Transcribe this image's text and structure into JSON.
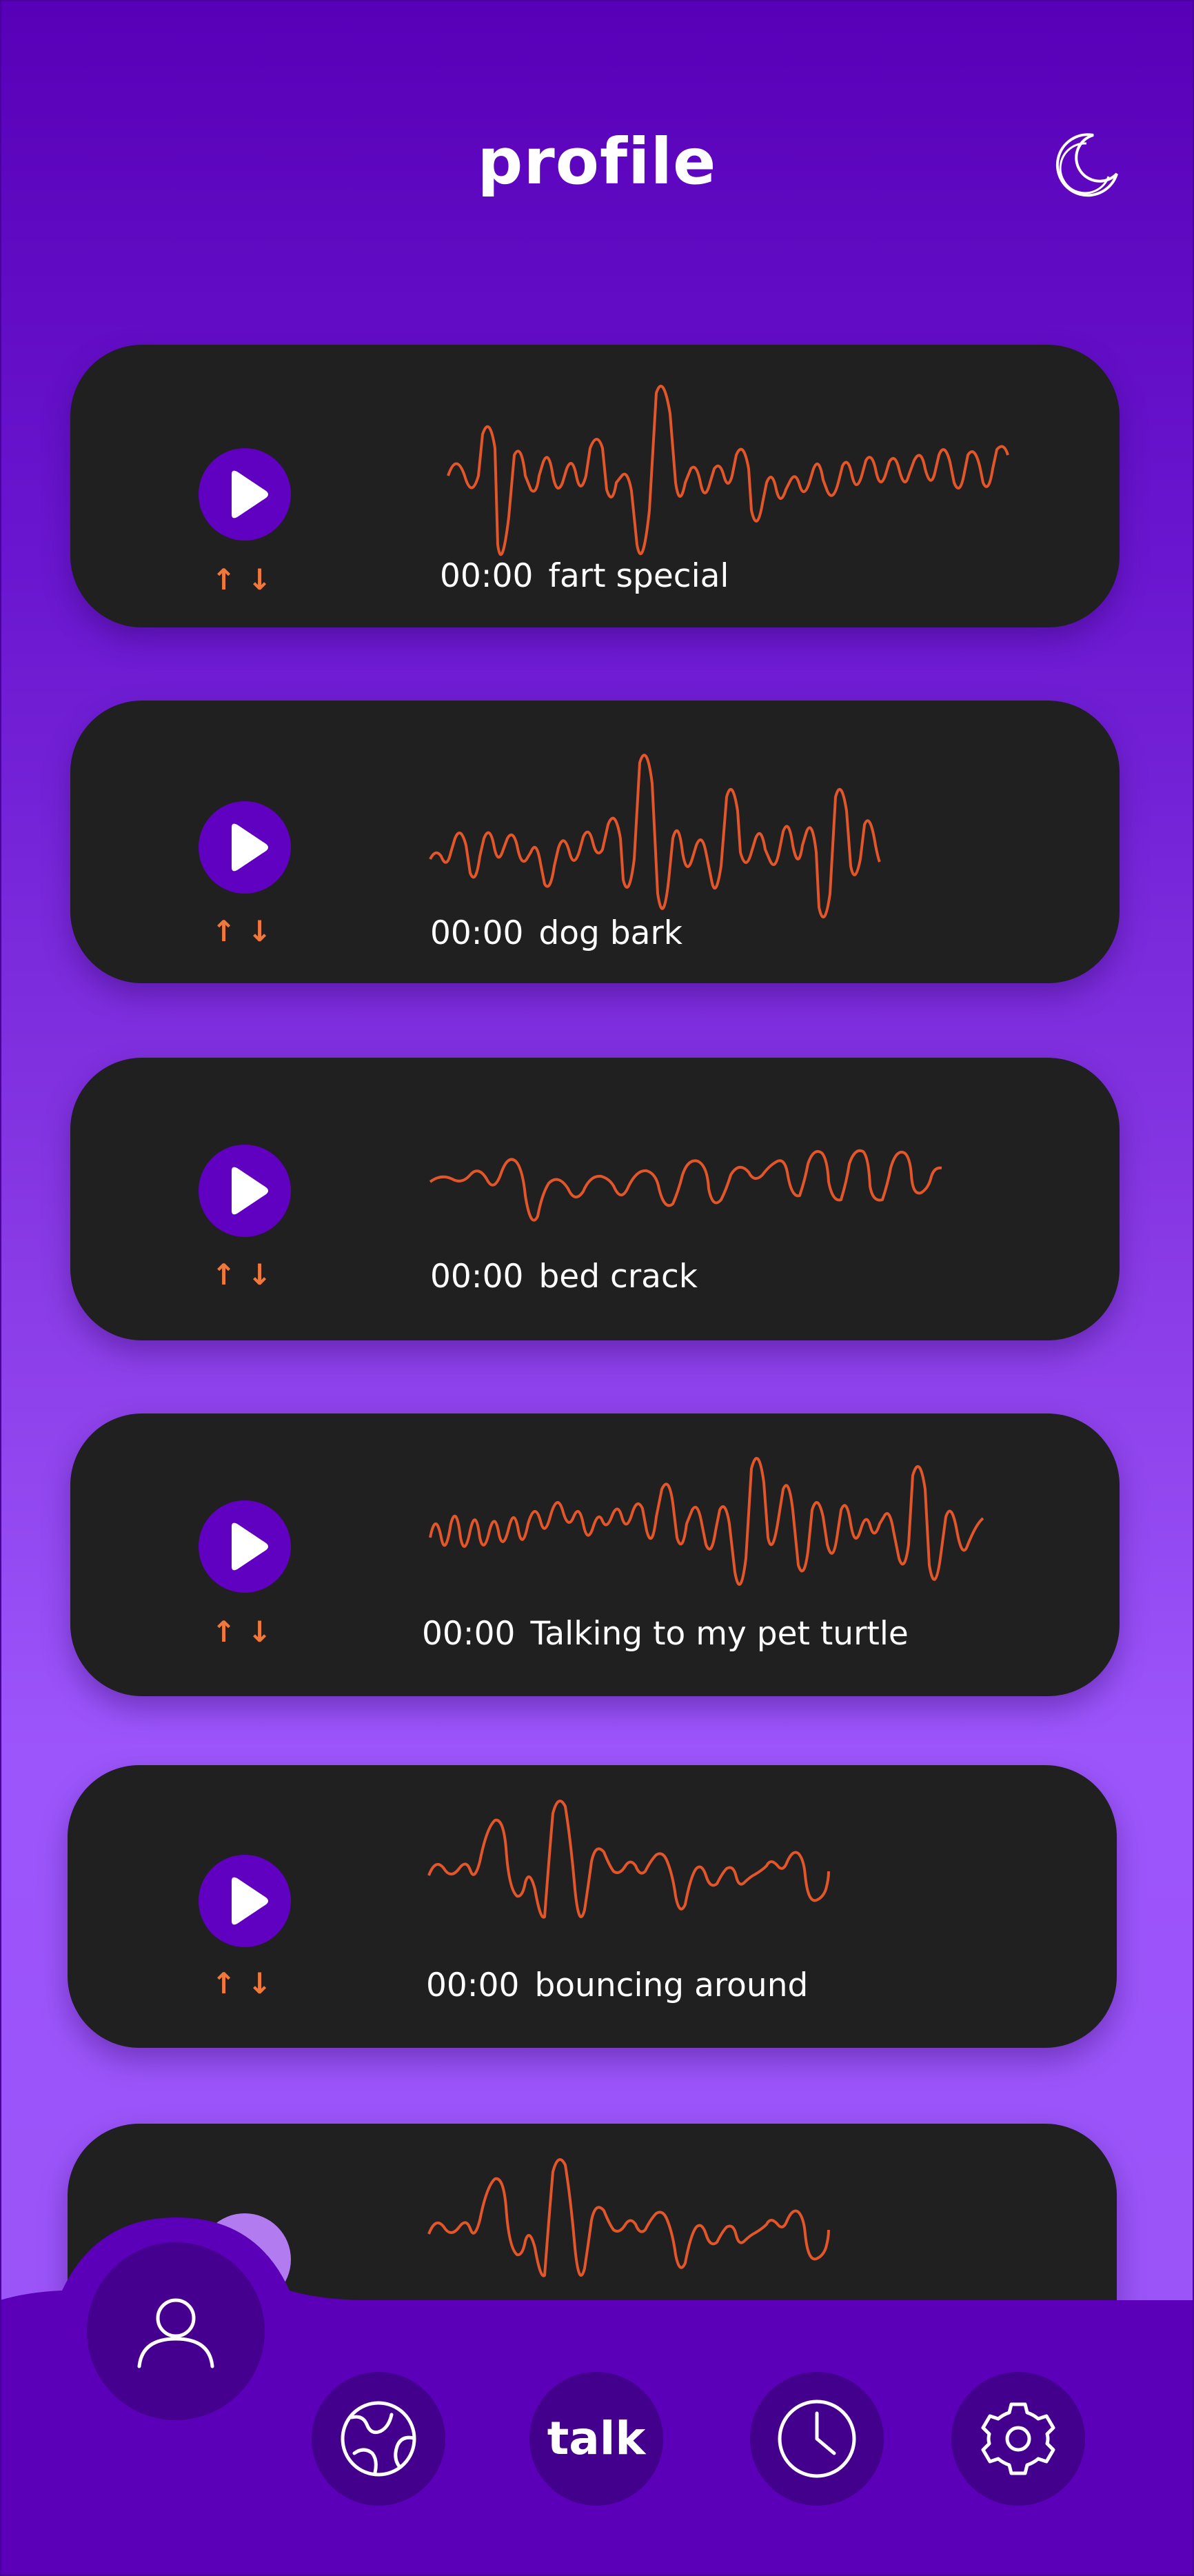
{
  "header": {
    "title": "profile",
    "theme_icon": "moon-icon"
  },
  "colors": {
    "background_top": "#5800b8",
    "background_bottom": "#9c55fb",
    "card": "#202020",
    "accent": "#6000c0",
    "waveform": "#e2562a",
    "arrows": "#f2773a"
  },
  "recordings": [
    {
      "time": "00:00",
      "name": "fart special"
    },
    {
      "time": "00:00",
      "name": "dog bark"
    },
    {
      "time": "00:00",
      "name": "bed crack"
    },
    {
      "time": "00:00",
      "name": "Talking to my pet turtle"
    },
    {
      "time": "00:00",
      "name": "bouncing around"
    },
    {
      "time": "",
      "name": ""
    }
  ],
  "nav": {
    "profile_icon": "user-icon",
    "explore_icon": "globe-icon",
    "talk_label": "talk",
    "history_icon": "clock-icon",
    "settings_icon": "gear-icon"
  }
}
